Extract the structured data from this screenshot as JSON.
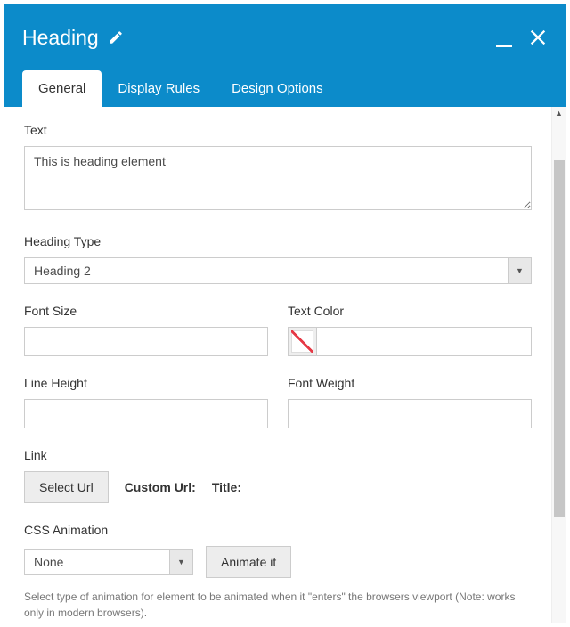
{
  "header": {
    "title": "Heading"
  },
  "tabs": [
    {
      "label": "General",
      "active": true
    },
    {
      "label": "Display Rules",
      "active": false
    },
    {
      "label": "Design Options",
      "active": false
    }
  ],
  "fields": {
    "text": {
      "label": "Text",
      "value": "This is heading element"
    },
    "heading_type": {
      "label": "Heading Type",
      "value": "Heading 2"
    },
    "font_size": {
      "label": "Font Size",
      "value": ""
    },
    "text_color": {
      "label": "Text Color",
      "value": ""
    },
    "line_height": {
      "label": "Line Height",
      "value": ""
    },
    "font_weight": {
      "label": "Font Weight",
      "value": ""
    },
    "link": {
      "label": "Link",
      "button": "Select Url",
      "custom_url_label": "Custom Url:",
      "title_label": "Title:"
    },
    "css_animation": {
      "label": "CSS Animation",
      "value": "None",
      "button": "Animate it",
      "help": "Select type of animation for element to be animated when it \"enters\" the browsers viewport (Note: works only in modern browsers)."
    }
  }
}
